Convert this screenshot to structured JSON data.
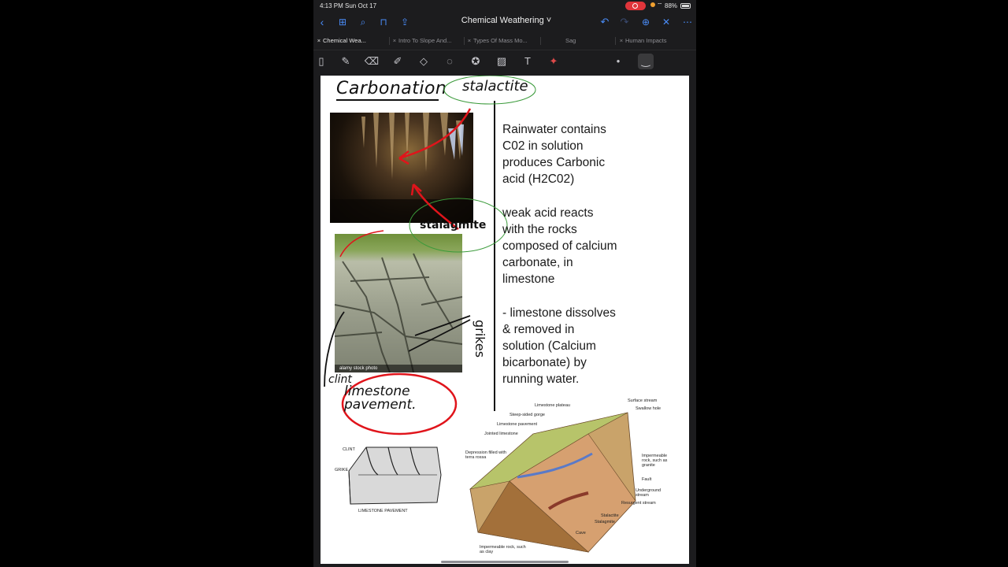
{
  "status_bar": {
    "time": "4:13 PM  Sun Oct 17",
    "battery": "88%"
  },
  "toolbar": {
    "title": "Chemical Weathering ˅"
  },
  "tabs": [
    {
      "label": "Chemical Wea..."
    },
    {
      "label": "Intro To Slope And..."
    },
    {
      "label": "Types Of Mass Mo..."
    },
    {
      "label": "Sag"
    },
    {
      "label": "Human Impacts"
    }
  ],
  "tools": [
    "page-icon",
    "pen-icon",
    "eraser-icon",
    "highlighter-icon",
    "shapes-icon",
    "lasso-icon",
    "star-icon",
    "image-icon",
    "text-icon",
    "laser-icon",
    "dot-color",
    "pen-style"
  ],
  "page": {
    "heading": "Carbonation",
    "circled_word": "stalactite",
    "stalagmite_label": "stalagmite",
    "grikes_label": "grikes",
    "clint_label": "clint",
    "limestone_pavement_label": "limestone pavement.",
    "paragraphs": [
      [
        "Rainwater contains",
        "C02 in solution",
        "produces Carbonic",
        "acid (H2C02)"
      ],
      [
        "weak acid reacts",
        "with the rocks",
        "composed of calcium",
        "carbonate, in",
        "limestone"
      ],
      [
        "- limestone dissolves",
        "& removed in",
        "solution (Calcium",
        "bicarbonate) by",
        "running water."
      ]
    ],
    "photo_watermark": "alamy stock photo",
    "sketch": {
      "clint": "CLINT",
      "grike": "GRIKE",
      "caption": "LIMESTONE PAVEMENT"
    },
    "diagram_labels": [
      "Limestone plateau",
      "Surface stream",
      "Swallow hole",
      "Steep-sided gorge",
      "Limestone pavement",
      "Jointed limestone",
      "Depression filled with terra rossa",
      "Impermeable rock, such as granite",
      "Fault",
      "Underground stream",
      "Resurgent stream",
      "Stalactite",
      "Stalagmite",
      "Cave",
      "Impermeable rock, such as clay"
    ]
  },
  "colors": {
    "accent": "#4a8cf7",
    "ink_red": "#e0141b",
    "ink_green": "#3a9a3a"
  }
}
